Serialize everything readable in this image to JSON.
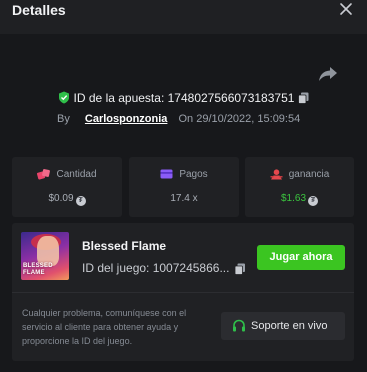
{
  "header": {
    "title": "Detalles"
  },
  "bet": {
    "id_label": "ID de la apuesta:",
    "id_value": "1748027566073183751",
    "by_label": "By",
    "username": "Carlosponzonia",
    "on_label": "On",
    "date": "29/10/2022, 15:09:54"
  },
  "stats": {
    "amount": {
      "label": "Cantidad",
      "value": "$0.09"
    },
    "payout": {
      "label": "Pagos",
      "value": "17.4 x"
    },
    "profit": {
      "label": "ganancia",
      "value": "$1.63"
    }
  },
  "game": {
    "name": "Blessed Flame",
    "thumb_text": "BLESSED FLAME",
    "id_text": "ID del juego: 1007245866...",
    "play_label": "Jugar ahora",
    "help_text": "Cualquier problema, comuníquese con el servicio al cliente para obtener ayuda y proporcione la ID del juego.",
    "support_label": "Soporte en vivo"
  },
  "colors": {
    "accent_green": "#3bc521",
    "profit_green": "#3bc43f",
    "shield_green": "#2fbf4a",
    "amount_pink": "#e9456b",
    "payout_purple": "#8a5cf6",
    "profit_red": "#e5484d"
  },
  "icons": [
    "close-icon",
    "share-icon",
    "shield-check-icon",
    "copy-icon",
    "dice-icon",
    "card-icon",
    "trophy-icon",
    "coin-icon",
    "headset-icon"
  ]
}
